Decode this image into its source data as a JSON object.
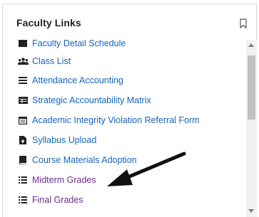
{
  "panel": {
    "title": "Faculty  Links"
  },
  "links": [
    {
      "label": "Faculty Detail Schedule",
      "icon": "table-icon",
      "visited": false
    },
    {
      "label": "Class List",
      "icon": "people-icon",
      "visited": false
    },
    {
      "label": "Attendance Accounting",
      "icon": "list-lines-icon",
      "visited": false
    },
    {
      "label": "Strategic Accountability Matrix",
      "icon": "grid-table-icon",
      "visited": false
    },
    {
      "label": "Academic Integrity Violation Referral Form",
      "icon": "form-window-icon",
      "visited": false
    },
    {
      "label": "Syllabus Upload",
      "icon": "file-upload-icon",
      "visited": false
    },
    {
      "label": "Course Materials Adoption",
      "icon": "book-icon",
      "visited": false
    },
    {
      "label": "Midterm Grades",
      "icon": "bullet-list-icon",
      "visited": true
    },
    {
      "label": "Final Grades",
      "icon": "bullet-list-icon",
      "visited": true
    }
  ],
  "colors": {
    "link": "#1565b8",
    "visited_link": "#6b2b8c",
    "annotation_arrow": "#111111"
  }
}
